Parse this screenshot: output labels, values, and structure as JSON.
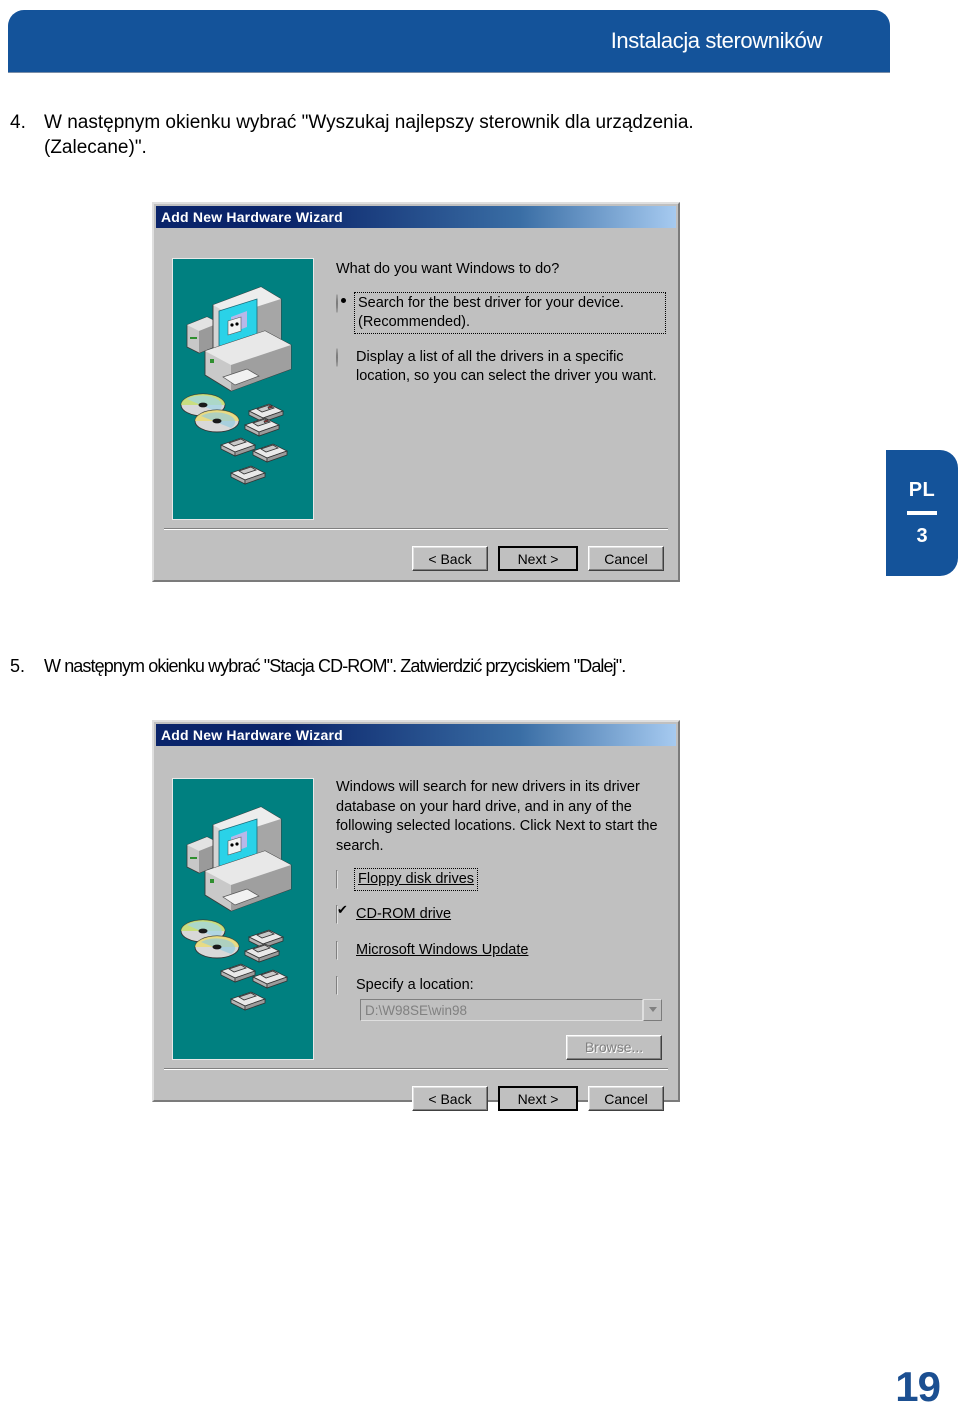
{
  "header": {
    "title": "Instalacja sterowników",
    "accent_color": "#14539A"
  },
  "side_tab": {
    "language": "PL",
    "section": "3"
  },
  "page_number": "19",
  "steps": [
    {
      "number": "4.",
      "text": "W następnym okienku wybrać \"Wyszukaj najlepszy sterownik dla urządzenia. (Zalecane)\"."
    },
    {
      "number": "5.",
      "text": "W następnym okienku wybrać \"Stacja CD-ROM\". Zatwierdzić przyciskiem \"Dalej\"."
    }
  ],
  "dialog1": {
    "title": "Add New Hardware Wizard",
    "prompt": "What do you want Windows to do?",
    "options": [
      {
        "label": "Search for the best driver for your device. (Recommended).",
        "selected": true,
        "focused": true
      },
      {
        "label": "Display a list of all the drivers in a specific location, so you can select the driver you want.",
        "selected": false,
        "focused": false
      }
    ],
    "buttons": {
      "back": "< Back",
      "next": "Next >",
      "cancel": "Cancel"
    }
  },
  "dialog2": {
    "title": "Add New Hardware Wizard",
    "prompt": "Windows will search for new drivers in its driver database on your hard drive, and in any of the following selected locations. Click Next to start the search.",
    "checkboxes": [
      {
        "label": "Floppy disk drives",
        "checked": false,
        "focused": true
      },
      {
        "label": "CD-ROM drive",
        "checked": true,
        "focused": false
      },
      {
        "label": "Microsoft Windows Update",
        "checked": false,
        "focused": false
      },
      {
        "label": "Specify a location:",
        "checked": false,
        "focused": false
      }
    ],
    "location_value": "D:\\W98SE\\win98",
    "browse_label": "Browse...",
    "buttons": {
      "back": "< Back",
      "next": "Next >",
      "cancel": "Cancel"
    }
  }
}
